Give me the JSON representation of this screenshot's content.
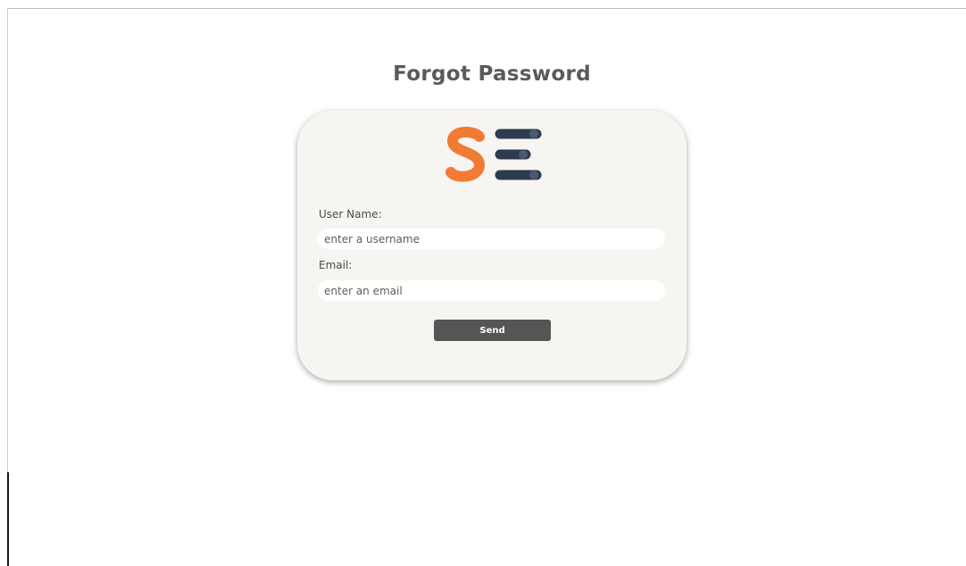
{
  "page": {
    "title": "Forgot Password"
  },
  "logo": {
    "icon": "se-logo",
    "colors": {
      "letter_s": "#f07b35",
      "bars": "#2e3a4d"
    }
  },
  "form": {
    "username_label": "User Name:",
    "username_placeholder": "enter a username",
    "username_value": "",
    "email_label": "Email:",
    "email_placeholder": "enter an email",
    "email_value": "",
    "send_label": "Send"
  },
  "colors": {
    "card_background": "#f7f5f1",
    "button_background": "#555555",
    "title_text": "#5a5a5a"
  }
}
